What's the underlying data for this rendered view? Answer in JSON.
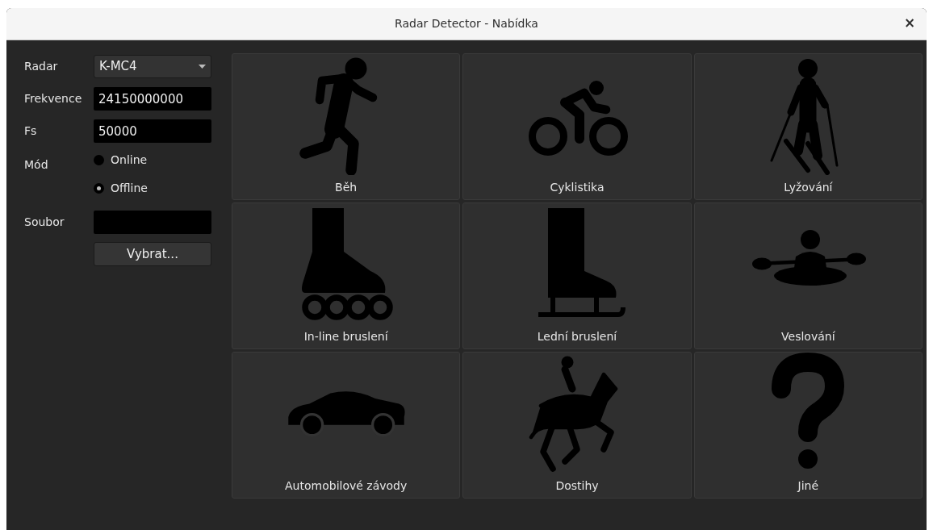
{
  "window": {
    "title": "Radar Detector - Nabídka",
    "close": "×"
  },
  "form": {
    "radar": {
      "label": "Radar",
      "value": "K-MC4"
    },
    "frequency": {
      "label": "Frekvence",
      "value": "24150000000"
    },
    "fs": {
      "label": "Fs",
      "value": "50000"
    },
    "mode": {
      "label": "Mód",
      "options": [
        {
          "label": "Online",
          "selected": false
        },
        {
          "label": "Offline",
          "selected": true
        }
      ]
    },
    "file": {
      "label": "Soubor",
      "button": "Vybrat..."
    }
  },
  "tiles": [
    {
      "kind": "run",
      "label": "Běh"
    },
    {
      "kind": "bike",
      "label": "Cyklistika"
    },
    {
      "kind": "ski",
      "label": "Lyžování"
    },
    {
      "kind": "inline",
      "label": "In-line bruslení"
    },
    {
      "kind": "iceskate",
      "label": "Lední bruslení"
    },
    {
      "kind": "kayak",
      "label": "Veslování"
    },
    {
      "kind": "car",
      "label": "Automobilové závody"
    },
    {
      "kind": "horse",
      "label": "Dostihy"
    },
    {
      "kind": "other",
      "label": "Jiné"
    }
  ]
}
